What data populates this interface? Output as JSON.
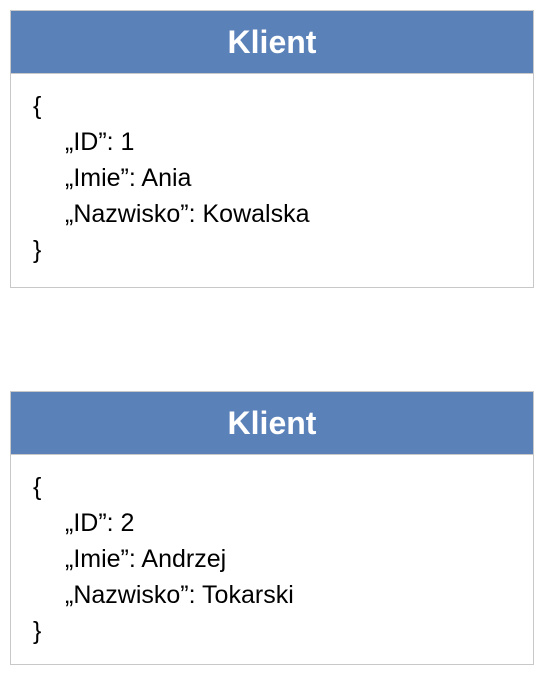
{
  "records": [
    {
      "title": "Klient",
      "open_brace": "{",
      "fields": [
        "„ID”: 1",
        "„Imie”: Ania",
        "„Nazwisko”: Kowalska"
      ],
      "close_brace": "}"
    },
    {
      "title": "Klient",
      "open_brace": "{",
      "fields": [
        "„ID”: 2",
        "„Imie”: Andrzej",
        "„Nazwisko”: Tokarski"
      ],
      "close_brace": "}"
    }
  ],
  "colors": {
    "header_bg": "#5b81b9",
    "header_text": "#ffffff",
    "border": "#c8c8c8"
  }
}
